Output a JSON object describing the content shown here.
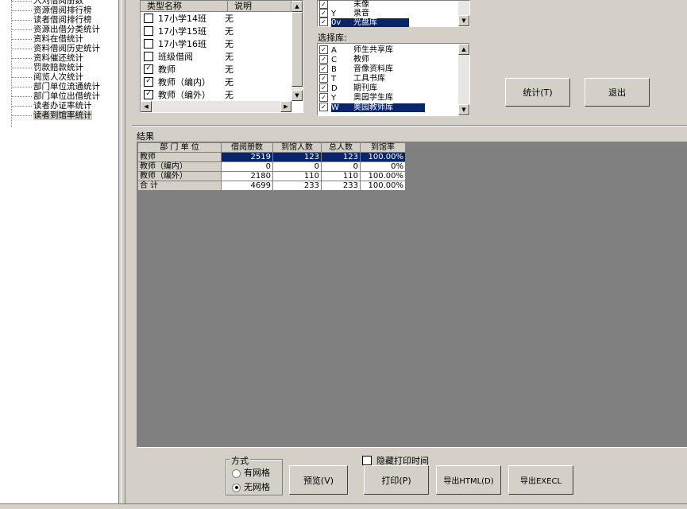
{
  "tree": {
    "items": [
      {
        "label": "入刈借阅册数"
      },
      {
        "label": "资源借阅排行榜"
      },
      {
        "label": "读者借阅排行榜"
      },
      {
        "label": "资源出借分类统计"
      },
      {
        "label": "资料在借统计"
      },
      {
        "label": "资料借阅历史统计"
      },
      {
        "label": "资料催还统计"
      },
      {
        "label": "罚款赔款统计"
      },
      {
        "label": "阅览人次统计"
      },
      {
        "label": "部门单位流通统计"
      },
      {
        "label": "部门单位出借统计"
      },
      {
        "label": "读者办证率统计"
      },
      {
        "label": "读者到馆率统计"
      }
    ]
  },
  "type_list": {
    "headers": [
      "类型名称",
      "说明"
    ],
    "rows": [
      {
        "name": "17小学14班",
        "desc": "无",
        "checked": false
      },
      {
        "name": "17小学15班",
        "desc": "无",
        "checked": false
      },
      {
        "name": "17小学16班",
        "desc": "无",
        "checked": false
      },
      {
        "name": "班级借阅",
        "desc": "无",
        "checked": false
      },
      {
        "name": "教师",
        "desc": "无",
        "checked": true
      },
      {
        "name": "教师（编内）",
        "desc": "无",
        "checked": true
      },
      {
        "name": "教师（编外）",
        "desc": "无",
        "checked": true
      }
    ]
  },
  "top_list": {
    "rows": [
      {
        "code": "",
        "name": "未像",
        "checked": true
      },
      {
        "code": "Y",
        "name": "录音",
        "checked": true
      },
      {
        "code": "0v",
        "name": "光盘库",
        "checked": true,
        "selected": true
      }
    ]
  },
  "library": {
    "label": "选择库:",
    "rows": [
      {
        "code": "A",
        "name": "师生共享库",
        "checked": true
      },
      {
        "code": "C",
        "name": "教师",
        "checked": true
      },
      {
        "code": "B",
        "name": "音像资料库",
        "checked": true
      },
      {
        "code": "T",
        "name": "工具书库",
        "checked": true
      },
      {
        "code": "D",
        "name": "期刊库",
        "checked": true
      },
      {
        "code": "Y",
        "name": "奥园学生库",
        "checked": true
      },
      {
        "code": "W",
        "name": "奥园教师库",
        "checked": true,
        "selected": true
      }
    ]
  },
  "buttons": {
    "stat": "统计(T)",
    "exit": "退出",
    "preview": "预览(V)",
    "print": "打印(P)",
    "export_html": "导出HTML(D)",
    "export_excel": "导出EXECL"
  },
  "result": {
    "label": "结果",
    "headers": [
      "部 门 单 位",
      "借阅册数",
      "到馆人数",
      "总人数",
      "到馆率"
    ],
    "rows": [
      {
        "unit": "教师",
        "borrow": "2519",
        "visit": "123",
        "total": "123",
        "rate": "100.00%",
        "selected": true
      },
      {
        "unit": "教师（编内）",
        "borrow": "0",
        "visit": "0",
        "total": "0",
        "rate": "0%"
      },
      {
        "unit": "教师（编外）",
        "borrow": "2180",
        "visit": "110",
        "total": "110",
        "rate": "100.00%"
      },
      {
        "unit": "  合 计",
        "borrow": "4699",
        "visit": "233",
        "total": "233",
        "rate": "100.00%"
      }
    ]
  },
  "mode": {
    "label": "方式",
    "options": [
      {
        "label": "有网格",
        "selected": false
      },
      {
        "label": "无网格",
        "selected": true
      }
    ]
  },
  "hide_print_time": {
    "label": "隐藏打印时间",
    "checked": false
  },
  "colors": {
    "selection": "#0a246a",
    "face": "#d4d0c8",
    "grid_bg": "#808080"
  }
}
